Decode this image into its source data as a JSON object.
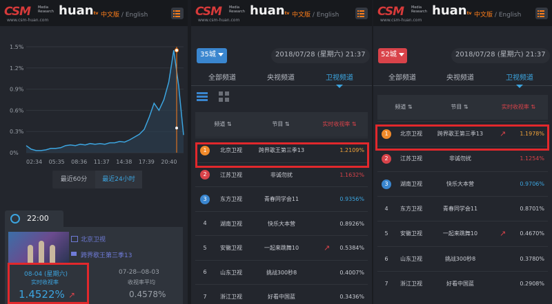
{
  "header": {
    "csm": "CSM",
    "csm_sub": "Media Research",
    "csm_url": "www.csm-huan.com",
    "huan": "huan",
    "huan_tv": "tv",
    "lang_zh": "中文版",
    "lang_sep": "/",
    "lang_en": "English"
  },
  "panel1": {
    "chart_data": {
      "type": "line",
      "title": "",
      "xlabel": "",
      "ylabel": "",
      "y_ticks": [
        "1.5%",
        "1.2%",
        "0.9%",
        "0.6%",
        "0.3%",
        "0%"
      ],
      "x_ticks": [
        "02:34",
        "05:35",
        "08:36",
        "11:37",
        "14:38",
        "17:39",
        "20:40"
      ],
      "ylim": [
        0,
        1.5
      ],
      "x": [
        0,
        1,
        2,
        3,
        4,
        5,
        6,
        7,
        8,
        9,
        10,
        11,
        12,
        13,
        14,
        15,
        16,
        17,
        18,
        19,
        20,
        21,
        22,
        23,
        24,
        25,
        26,
        27,
        28,
        29,
        30,
        31,
        32
      ],
      "values": [
        0.1,
        0.05,
        0.03,
        0.03,
        0.04,
        0.06,
        0.06,
        0.07,
        0.1,
        0.11,
        0.1,
        0.12,
        0.11,
        0.13,
        0.12,
        0.13,
        0.12,
        0.14,
        0.14,
        0.16,
        0.15,
        0.18,
        0.22,
        0.26,
        0.33,
        0.5,
        0.7,
        0.6,
        0.75,
        1.0,
        1.45,
        0.95,
        0.25
      ],
      "series": [
        {
          "name": "",
          "color": "#3ca5e0"
        }
      ],
      "grid": true,
      "marker_time": "22:00"
    },
    "seg_options": [
      "最近60分",
      "最近24小时"
    ],
    "time": "22:00",
    "channel": "北京卫视",
    "program": "跨界歌王第三季13",
    "date_now": "08-04 (星期六)",
    "label_now": "实时收视率",
    "value_now": "1.4522%",
    "date_range": "07-28--08-03",
    "label_avg": "收视率平均",
    "value_avg": "0.4578%"
  },
  "panel2": {
    "city": "35城",
    "date": "2018/07/28 (星期六) 21:37",
    "tabs": [
      "全部频道",
      "央视频道",
      "卫视频道"
    ],
    "th_channel": "频道",
    "th_program": "节目",
    "th_rating": "实时收视率",
    "rows": [
      {
        "rank": "1",
        "channel": "北京卫视",
        "program": "跨界歌王第三季13",
        "rating": "1.2109%",
        "rating_color": "#f2a33a",
        "trend": ""
      },
      {
        "rank": "2",
        "channel": "江苏卫视",
        "program": "非诚勿扰",
        "rating": "1.1632%",
        "rating_color": "#d9434a",
        "trend": ""
      },
      {
        "rank": "3",
        "channel": "东方卫视",
        "program": "青春同学会11",
        "rating": "0.9356%",
        "rating_color": "#3ca5e0",
        "trend": ""
      },
      {
        "rank": "4",
        "channel": "湖南卫视",
        "program": "快乐大本营",
        "rating": "0.8926%",
        "rating_color": "#c8cbd2",
        "trend": ""
      },
      {
        "rank": "5",
        "channel": "安徽卫视",
        "program": "一起来跳舞10",
        "rating": "0.5384%",
        "rating_color": "#c8cbd2",
        "trend": "↗"
      },
      {
        "rank": "6",
        "channel": "山东卫视",
        "program": "挑战300秒8",
        "rating": "0.4007%",
        "rating_color": "#c8cbd2",
        "trend": ""
      },
      {
        "rank": "7",
        "channel": "浙江卫视",
        "program": "好看中国蓝",
        "rating": "0.3436%",
        "rating_color": "#c8cbd2",
        "trend": ""
      }
    ]
  },
  "panel3": {
    "city": "52城",
    "date": "2018/07/28 (星期六) 21:37",
    "tabs": [
      "全部频道",
      "央视频道",
      "卫视频道"
    ],
    "th_channel": "频道",
    "th_program": "节目",
    "th_rating": "实时收视率",
    "rows": [
      {
        "rank": "1",
        "channel": "北京卫视",
        "program": "跨界歌王第三季13",
        "rating": "1.1978%",
        "rating_color": "#f2a33a",
        "trend": "↗"
      },
      {
        "rank": "2",
        "channel": "江苏卫视",
        "program": "非诚勿扰",
        "rating": "1.1254%",
        "rating_color": "#d9434a",
        "trend": ""
      },
      {
        "rank": "3",
        "channel": "湖南卫视",
        "program": "快乐大本营",
        "rating": "0.9706%",
        "rating_color": "#3ca5e0",
        "trend": ""
      },
      {
        "rank": "4",
        "channel": "东方卫视",
        "program": "青春同学会11",
        "rating": "0.8701%",
        "rating_color": "#c8cbd2",
        "trend": ""
      },
      {
        "rank": "5",
        "channel": "安徽卫视",
        "program": "一起来跳舞10",
        "rating": "0.4670%",
        "rating_color": "#c8cbd2",
        "trend": "↗"
      },
      {
        "rank": "6",
        "channel": "山东卫视",
        "program": "挑战300秒8",
        "rating": "0.3780%",
        "rating_color": "#c8cbd2",
        "trend": ""
      },
      {
        "rank": "7",
        "channel": "浙江卫视",
        "program": "好看中国蓝",
        "rating": "0.2908%",
        "rating_color": "#c8cbd2",
        "trend": ""
      }
    ]
  }
}
